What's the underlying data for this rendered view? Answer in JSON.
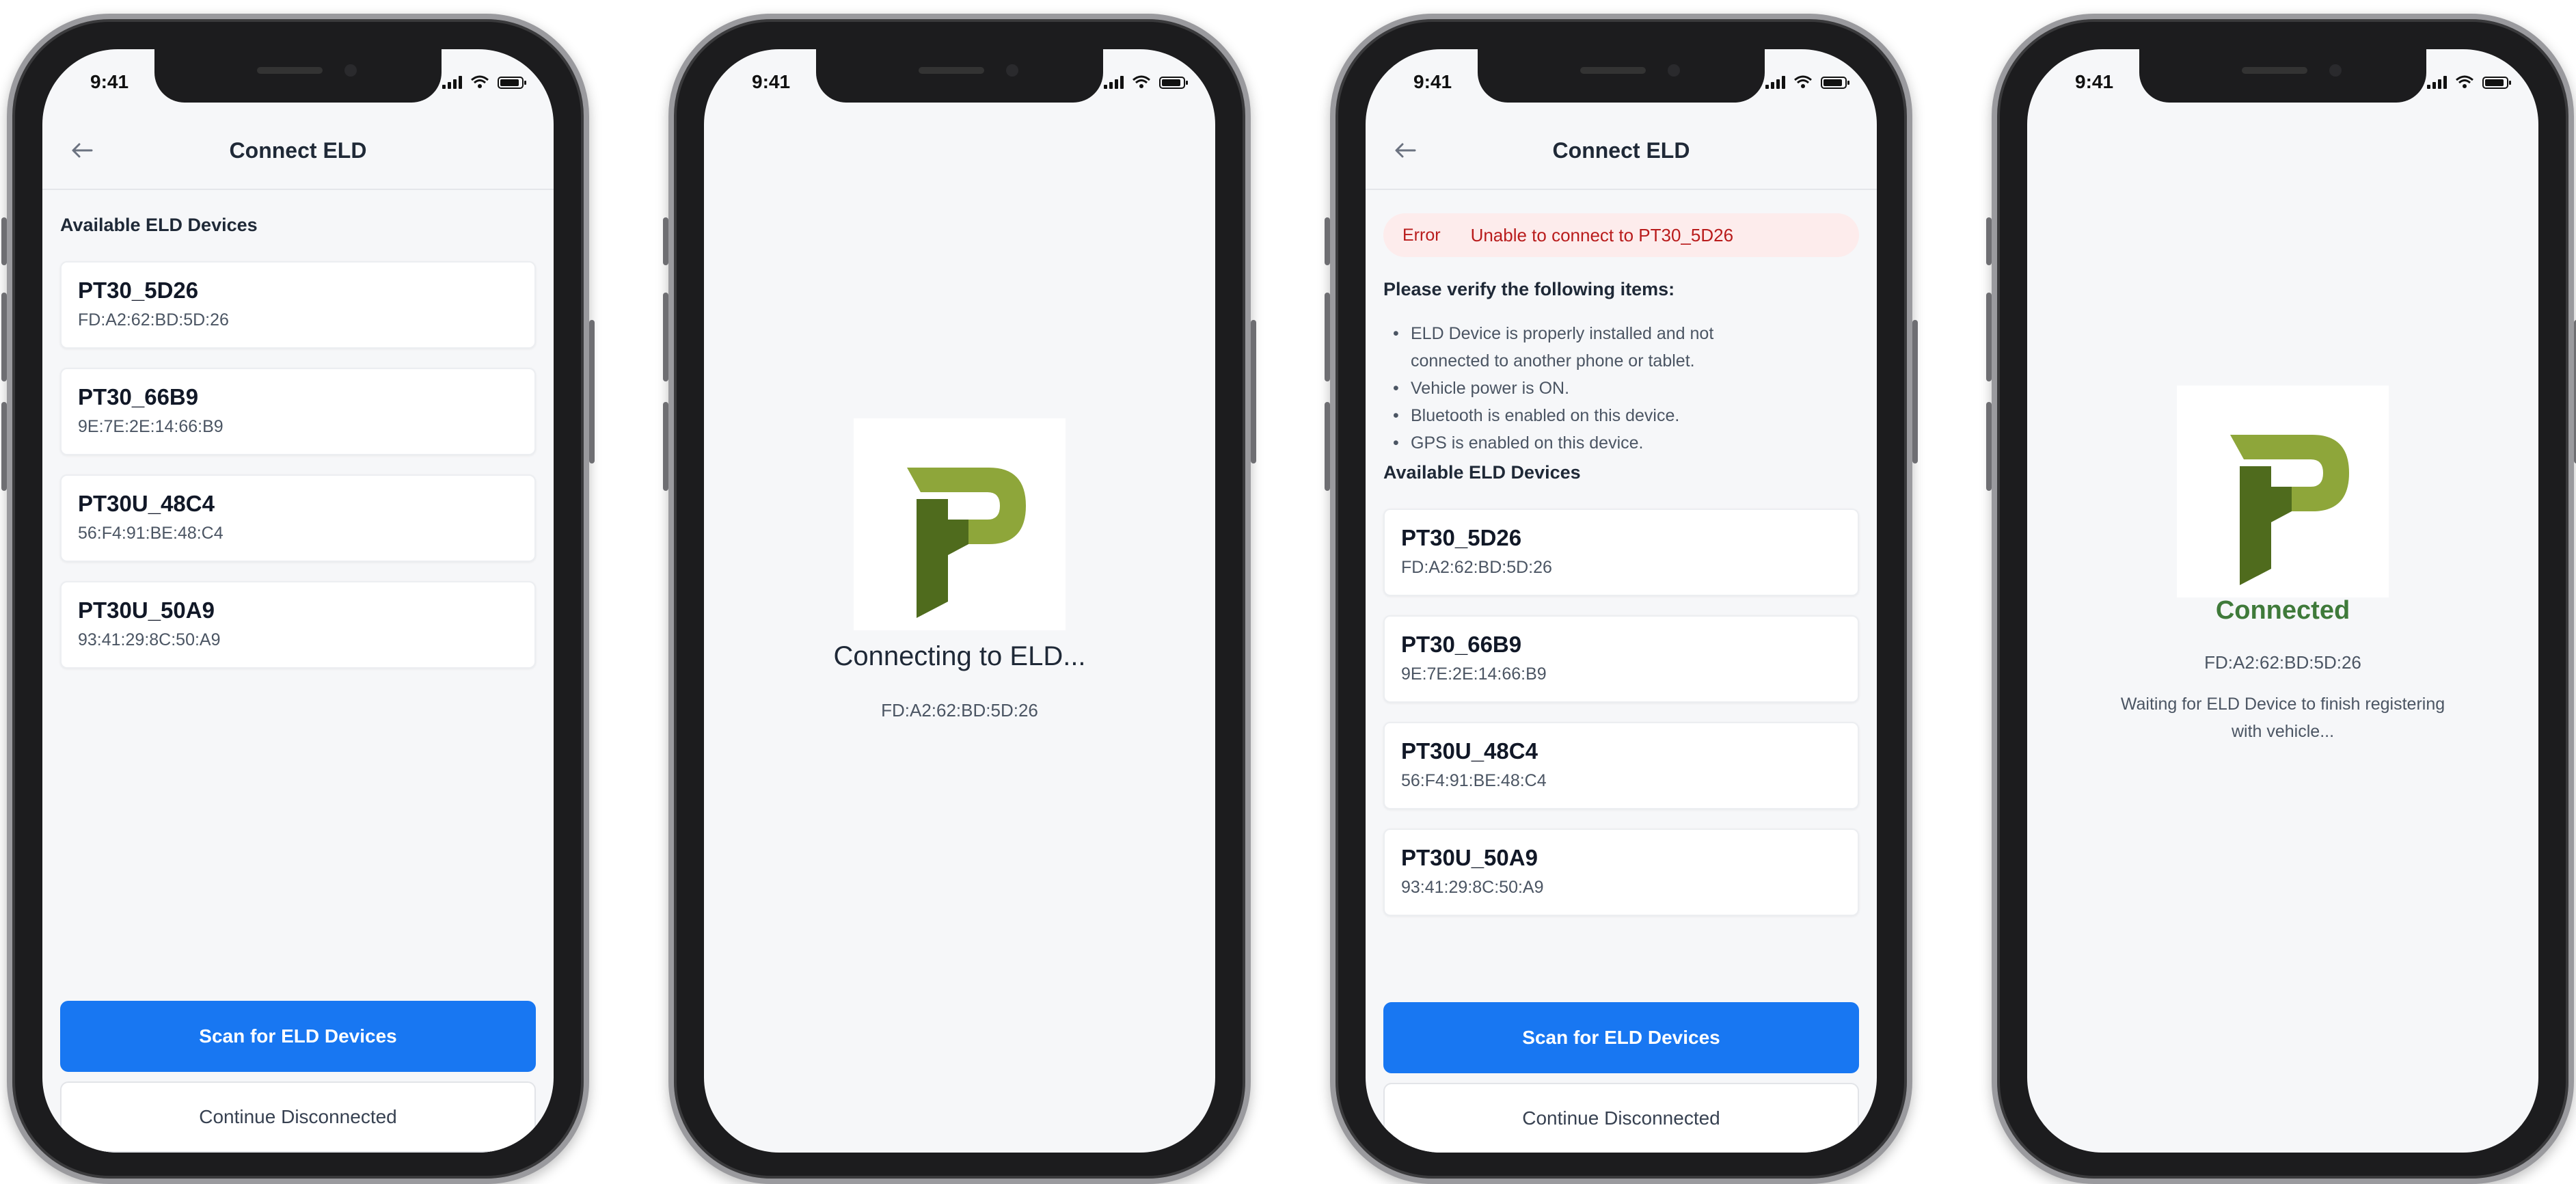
{
  "status_bar": {
    "time": "9:41"
  },
  "common": {
    "header_title": "Connect ELD",
    "available_title": "Available ELD Devices",
    "scan_button": "Scan for ELD Devices",
    "continue_button": "Continue Disconnected"
  },
  "devices": [
    {
      "name": "PT30_5D26",
      "mac": "FD:A2:62:BD:5D:26"
    },
    {
      "name": "PT30_66B9",
      "mac": "9E:7E:2E:14:66:B9"
    },
    {
      "name": "PT30U_48C4",
      "mac": "56:F4:91:BE:48:C4"
    },
    {
      "name": "PT30U_50A9",
      "mac": "93:41:29:8C:50:A9"
    }
  ],
  "connecting": {
    "title": "Connecting to ELD...",
    "mac": "FD:A2:62:BD:5D:26"
  },
  "error": {
    "tag": "Error",
    "message": "Unable to connect to PT30_5D26",
    "verify_title": "Please verify the following items:",
    "items": [
      "ELD Device is properly installed and not",
      "connected to another phone or tablet.",
      "Vehicle power is ON.",
      "Bluetooth is enabled on this device.",
      "GPS is enabled on this device."
    ]
  },
  "connected": {
    "title": "Connected",
    "mac": "FD:A2:62:BD:5D:26",
    "line1": "Waiting for ELD Device to finish registering",
    "line2": "with vehicle..."
  },
  "colors": {
    "primary": "#1877f2",
    "logo_dark": "#4f6b1d",
    "logo_light": "#8ea63a",
    "connected_green": "#3f7a3a",
    "error_red": "#b91c1c"
  }
}
